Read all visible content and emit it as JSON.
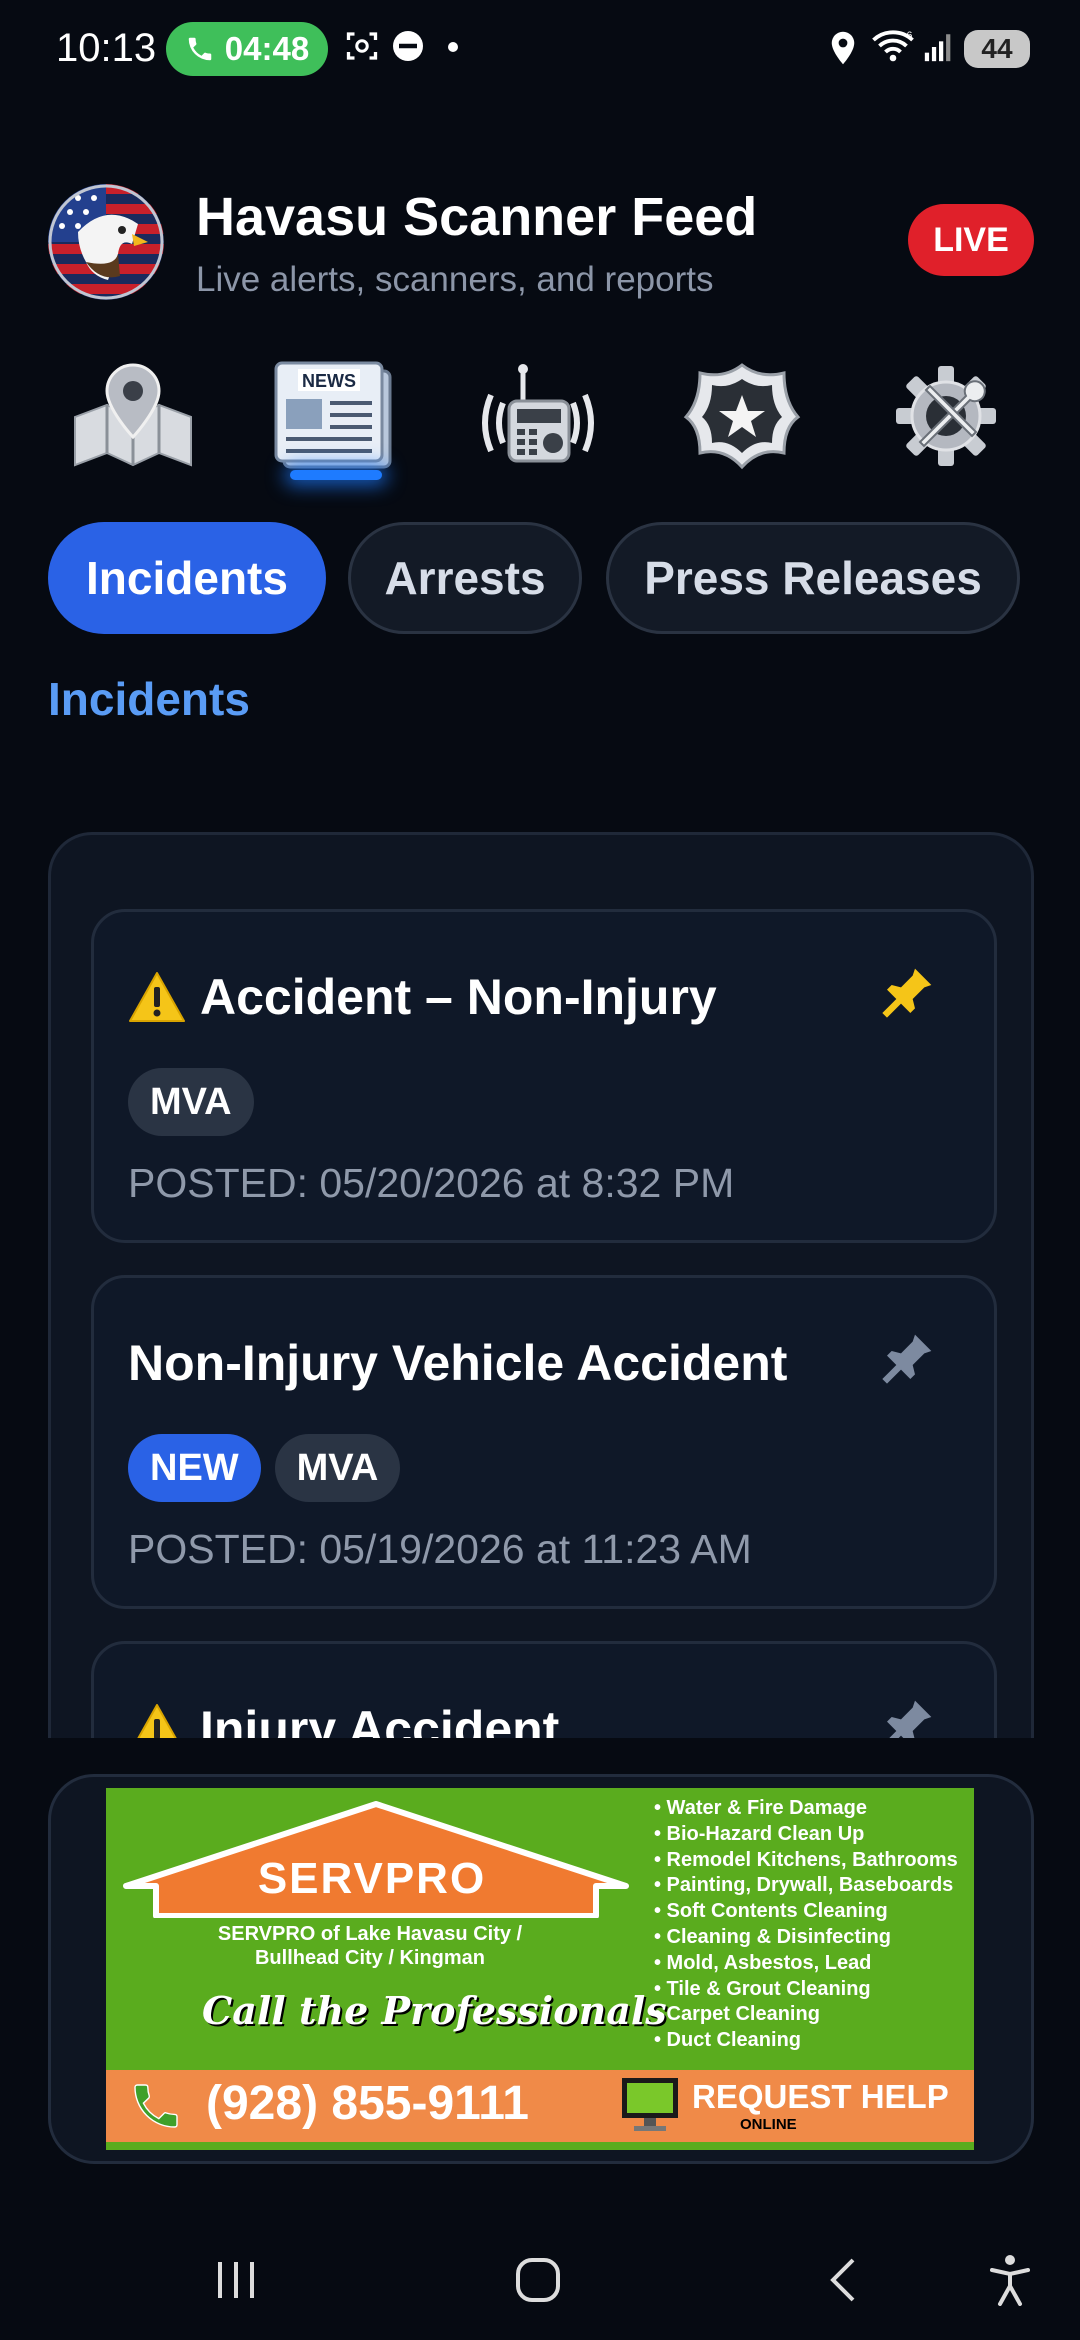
{
  "status_bar": {
    "time": "10:13",
    "call_timer": "04:48",
    "battery": "44"
  },
  "header": {
    "title": "Havasu Scanner Feed",
    "subtitle": "Live alerts, scanners, and reports",
    "live_label": "LIVE",
    "logo_icon": "eagle-flag-logo"
  },
  "categories": [
    {
      "icon": "map-pin-icon"
    },
    {
      "icon": "news-icon",
      "active": true
    },
    {
      "icon": "radio-scanner-icon"
    },
    {
      "icon": "police-badge-icon"
    },
    {
      "icon": "settings-gear-icon"
    }
  ],
  "tabs": [
    {
      "label": "Incidents",
      "active": true
    },
    {
      "label": "Arrests",
      "active": false
    },
    {
      "label": "Press Releases",
      "active": false
    }
  ],
  "section_title": "Incidents",
  "incidents": [
    {
      "title": "Accident – Non-Injury",
      "warning": true,
      "pinned": true,
      "tags": [
        "MVA"
      ],
      "posted": "POSTED: 05/20/2026 at 8:32 PM"
    },
    {
      "title": "Non-Injury Vehicle Accident",
      "warning": false,
      "pinned": false,
      "tags": [
        "NEW",
        "MVA"
      ],
      "posted": "POSTED: 05/19/2026 at 11:23 AM"
    },
    {
      "title": "Injury Accident",
      "warning": true,
      "pinned": false,
      "tags": [],
      "posted": ""
    }
  ],
  "ad": {
    "brand": "SERVPRO",
    "company": "SERVPRO of Lake Havasu City / Bullhead City / Kingman",
    "slogan": "Call the Professionals",
    "services": [
      "• Water & Fire Damage",
      "• Bio-Hazard Clean Up",
      "• Remodel Kitchens, Bathrooms",
      "• Painting, Drywall, Baseboards",
      "• Soft Contents Cleaning",
      "• Cleaning & Disinfecting",
      "• Mold, Asbestos, Lead",
      "• Tile & Grout Cleaning",
      "• Carpet Cleaning",
      "• Duct Cleaning"
    ],
    "phone": "(928) 855-9111",
    "cta": "REQUEST HELP",
    "cta_sub": "ONLINE"
  },
  "colors": {
    "background": "#060a12",
    "accent_blue": "#2a62e6",
    "section_blue": "#5a9cf5",
    "live_red": "#e0202a",
    "pin_active": "#f5c518",
    "pin_inactive": "#7d8aa0",
    "ad_green": "#5aac1e",
    "ad_orange": "#f08a48"
  }
}
